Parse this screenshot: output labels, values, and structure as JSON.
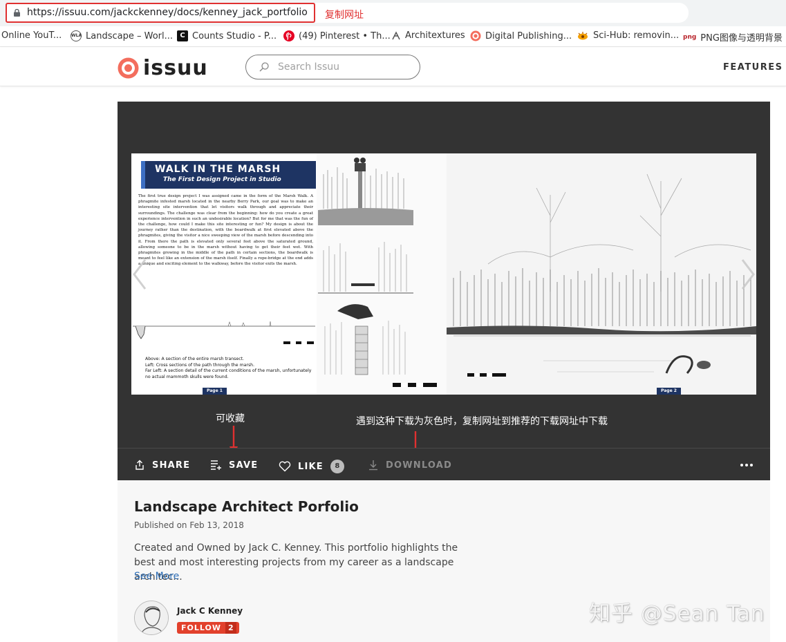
{
  "browser": {
    "url": "https://issuu.com/jackckenney/docs/kenney_jack_portfolio",
    "bookmarks": [
      {
        "label": "Online YouT..."
      },
      {
        "label": "Landscape – Worl...",
        "icon_text": "WLA"
      },
      {
        "label": "Counts Studio - P...",
        "icon_text": "C"
      },
      {
        "label": "(49) Pinterest • Th..."
      },
      {
        "label": "Architextures"
      },
      {
        "label": "Digital Publishing..."
      },
      {
        "label": "Sci-Hub: removin..."
      },
      {
        "label": "PNG图像与透明背景",
        "icon_text": "png"
      }
    ]
  },
  "annotations": {
    "copy_url": "复制网址",
    "save_note": "可收藏",
    "download_note": "遇到这种下载为灰色时，复制网址到推荐的下载网址中下载"
  },
  "header": {
    "logo_text": "issuu",
    "search_placeholder": "Search Issuu",
    "features_label": "FEATURES"
  },
  "document": {
    "title": "WALK IN THE MARSH",
    "subtitle": "The First Design Project in Studio",
    "body": "The first true design project I was assigned came in the form of the Marsh Walk. A phragmite infested marsh located in the nearby Berry Park, our goal was to make an interesting site intervention that let visitors walk through and appreciate their surroundings. The challenge was clear from the beginning: how do you create a great experience intervention in such an undesirable location? But for me that was the fun of the challenge, how could I make this site interesting or fun? My design is about the journey rather than the destination, with the boardwalk at first elevated above the phragmites, giving the visitor a nice sweeping view of the marsh before descending into it. From there the path is elevated only several feet above the saturated ground, allowing someone to be in the marsh without having to get their feet wet. With phragmites growing in the middle of the path in certain sections, the boardwalk is meant to feel like an extension of the marsh itself. Finally a rope-bridge at the end adds a unique and exciting element to the walkway, before the visitor exits the marsh.",
    "caption_above": "Above: A section of the entire marsh transect.",
    "caption_left": "Left: Cross sections of the path through the marsh.",
    "caption_far_left": "Far Left: A section detail of the current conditions of the marsh, unfortunately no actual mammoth skulls were found.",
    "page1": "Page 1",
    "page2": "Page 2"
  },
  "actions": {
    "share": "SHARE",
    "save": "SAVE",
    "like": "LIKE",
    "like_count": "8",
    "download": "DOWNLOAD"
  },
  "publication": {
    "title": "Landscape Architect Porfolio",
    "published": "Published on Feb 13, 2018",
    "description": "Created and Owned by Jack C. Kenney. This portfolio highlights the best and most interesting projects from my career as a landscape architec...",
    "see_more": "See More",
    "author": "Jack C Kenney",
    "follow_label": "FOLLOW",
    "follow_count": "2"
  },
  "watermark": "知乎 @Sean Tan",
  "colors": {
    "issuu_red": "#f36d5d",
    "annotation_red": "#e03030",
    "viewer_bg": "#333333",
    "follow_red": "#e2412c",
    "link_blue": "#2f6fb7"
  }
}
